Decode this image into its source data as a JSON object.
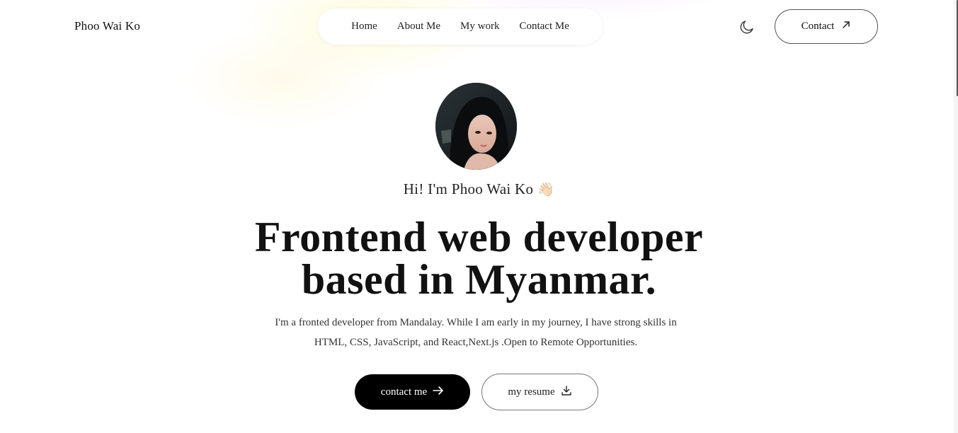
{
  "header": {
    "logo": "Phoo Wai Ko",
    "nav_items": [
      {
        "label": "Home"
      },
      {
        "label": "About Me"
      },
      {
        "label": "My work"
      },
      {
        "label": "Contact Me"
      }
    ],
    "theme_toggle_icon": "moon-icon",
    "contact_button": {
      "label": "Contact",
      "icon": "arrow-up-right-icon"
    }
  },
  "hero": {
    "avatar_icon": "profile-photo",
    "greeting": "Hi! I'm Phoo Wai Ko",
    "greeting_emoji": "👋🏻",
    "headline_line1": "Frontend web developer",
    "headline_line2": "based in Myanmar.",
    "description_line1": "I'm a fronted developer from Mandalay. While I am early in my journey, I have strong skills in",
    "description_line2": "HTML, CSS, JavaScript, and React,Next.js .Open to Remote Opportunities.",
    "primary_button": {
      "label": "contact me",
      "icon": "arrow-right-icon"
    },
    "secondary_button": {
      "label": "my resume",
      "icon": "download-icon"
    }
  },
  "colors": {
    "primary_button_bg": "#000000",
    "text": "#111111",
    "background": "#ffffff"
  }
}
